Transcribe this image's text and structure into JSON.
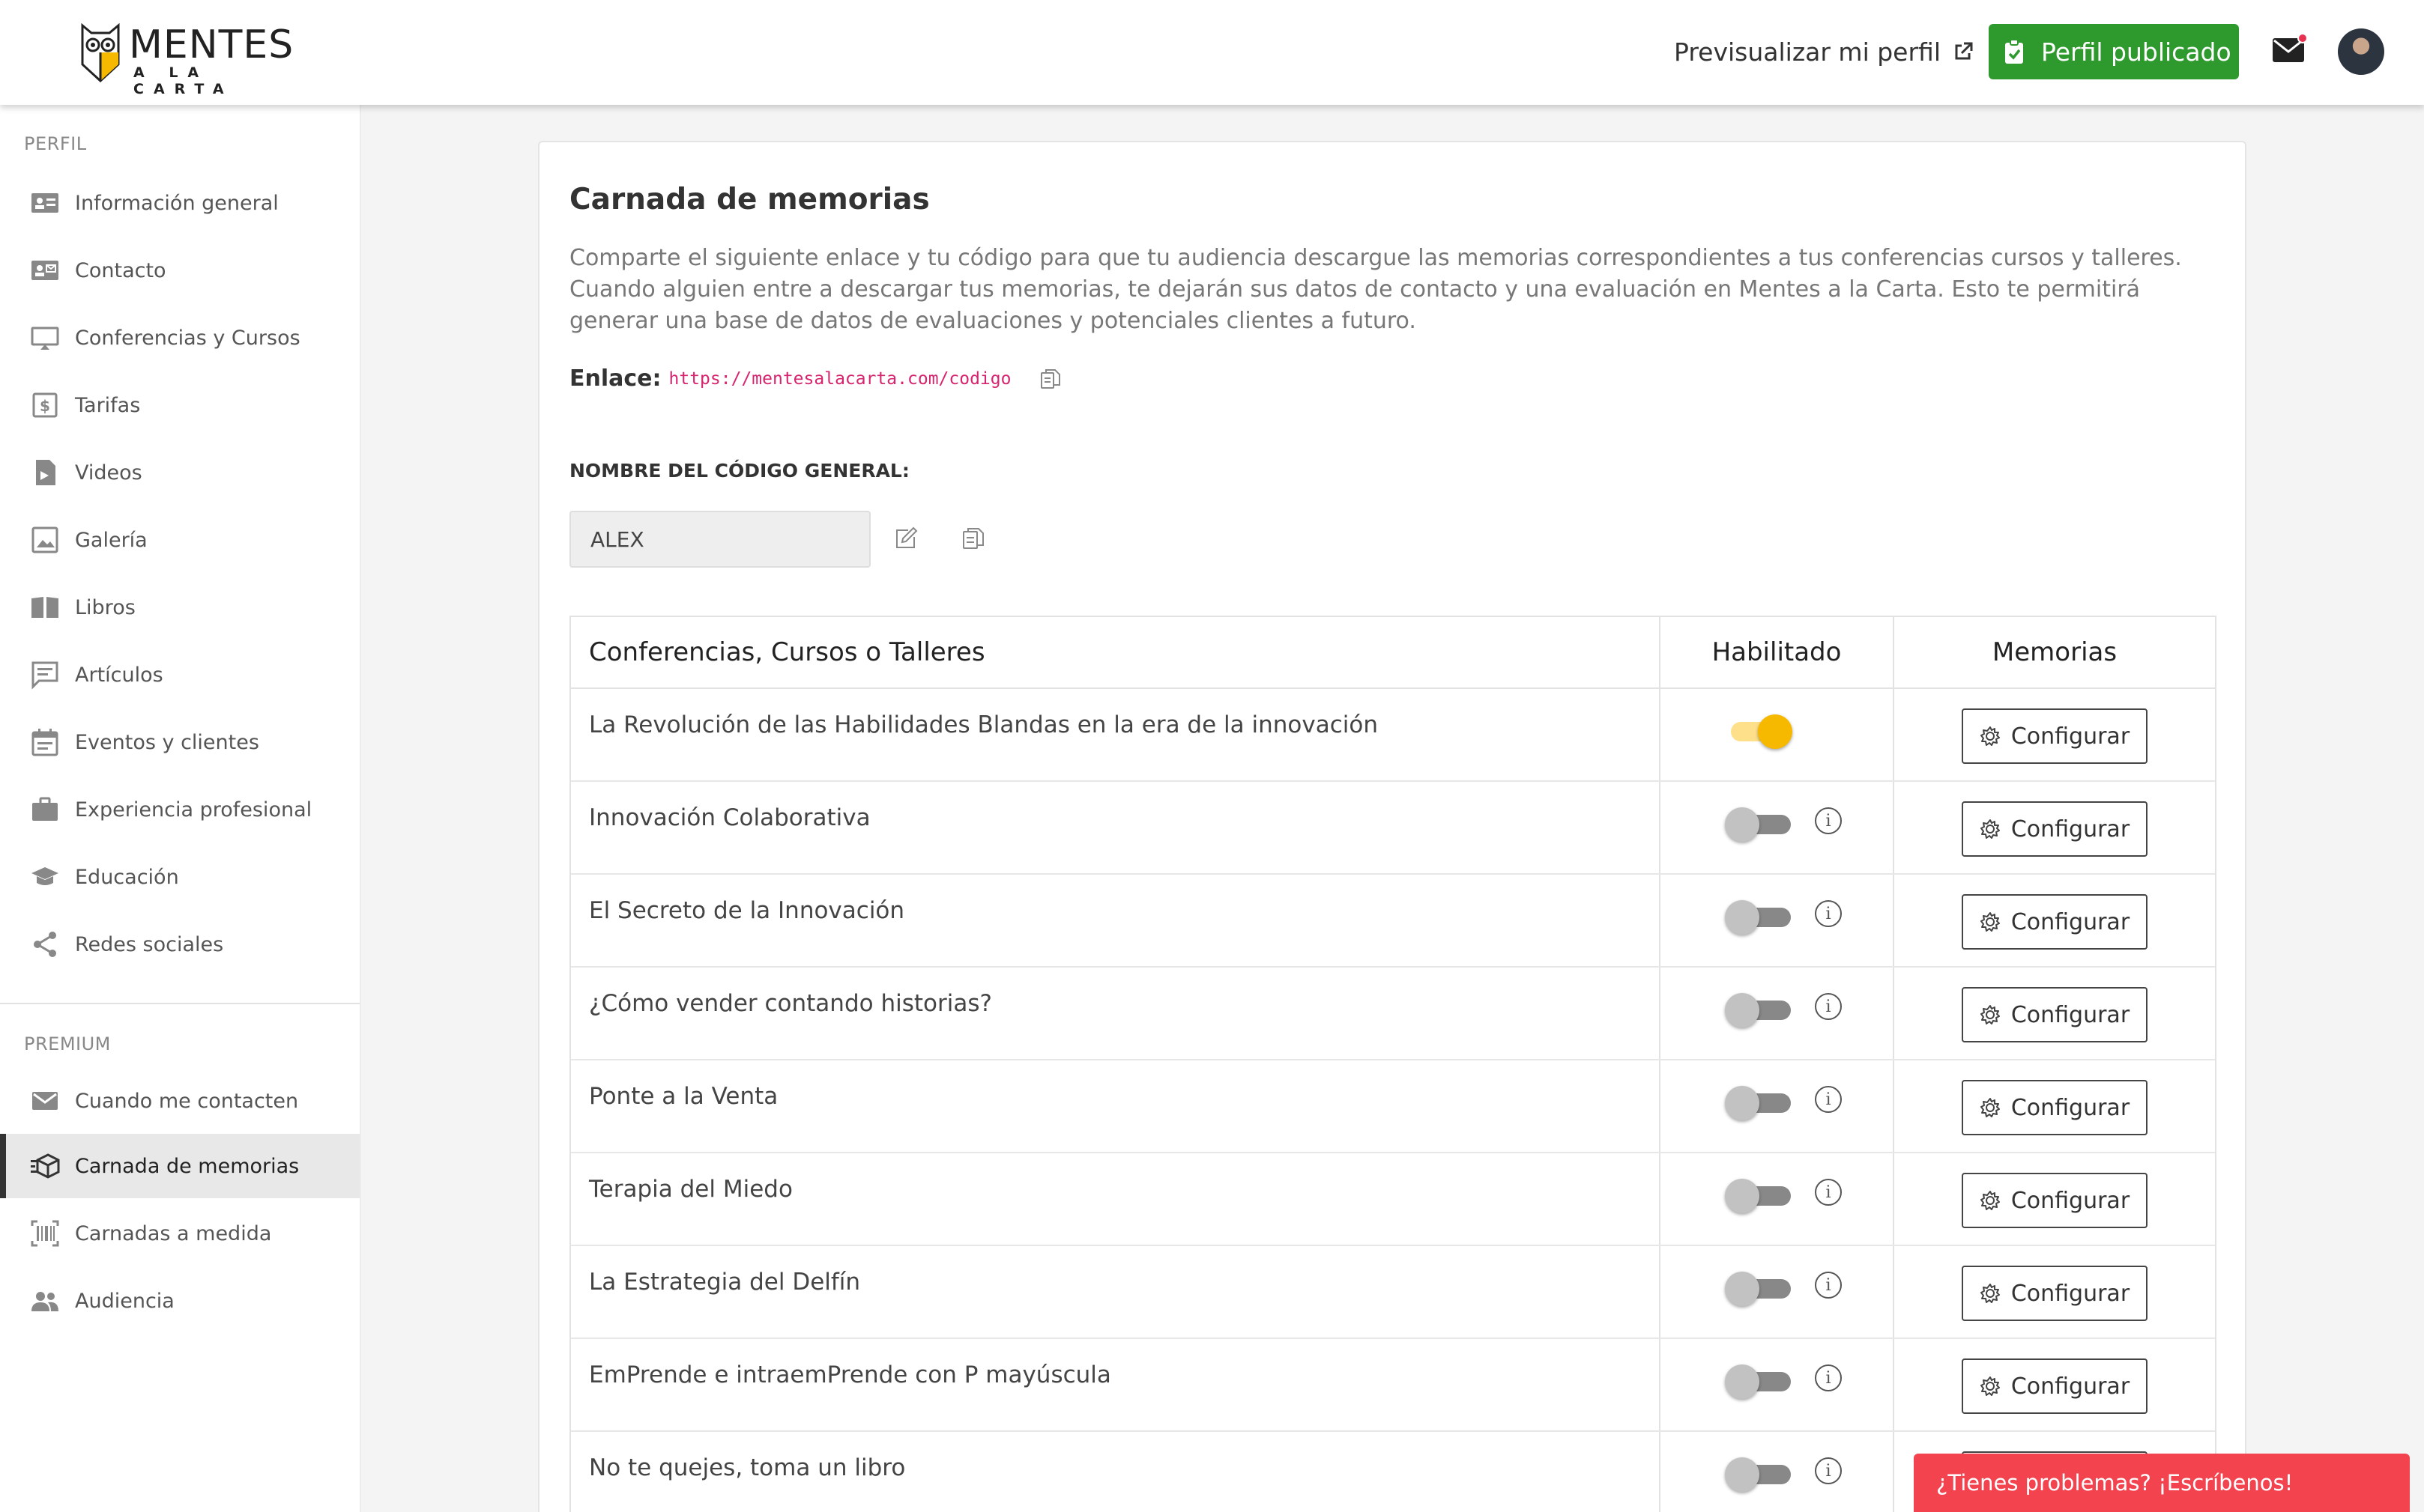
{
  "logo": {
    "word1": "MENTES",
    "word2": "A LA CARTA"
  },
  "header": {
    "preview_label": "Previsualizar mi perfil",
    "published_label": "Perfil publicado"
  },
  "sidebar": {
    "section_profile": "PERFIL",
    "profile_items": [
      {
        "label": "Información general",
        "icon": "id-card-icon"
      },
      {
        "label": "Contacto",
        "icon": "contact-card-icon"
      },
      {
        "label": "Conferencias y Cursos",
        "icon": "monitor-icon"
      },
      {
        "label": "Tarifas",
        "icon": "dollar-icon"
      },
      {
        "label": "Videos",
        "icon": "video-file-icon"
      },
      {
        "label": "Galería",
        "icon": "image-icon"
      },
      {
        "label": "Libros",
        "icon": "book-icon"
      },
      {
        "label": "Artículos",
        "icon": "comment-icon"
      },
      {
        "label": "Eventos y clientes",
        "icon": "calendar-icon"
      },
      {
        "label": "Experiencia profesional",
        "icon": "briefcase-icon"
      },
      {
        "label": "Educación",
        "icon": "graduation-cap-icon"
      },
      {
        "label": "Redes sociales",
        "icon": "share-icon"
      }
    ],
    "section_premium": "PREMIUM",
    "premium_items": [
      {
        "label": "Cuando me contacten",
        "icon": "envelope-icon"
      },
      {
        "label": "Carnada de memorias",
        "icon": "box-icon",
        "active": true
      },
      {
        "label": "Carnadas a medida",
        "icon": "barcode-icon"
      },
      {
        "label": "Audiencia",
        "icon": "people-icon"
      }
    ]
  },
  "main": {
    "title": "Carnada de memorias",
    "description": "Comparte el siguiente enlace y tu código para que tu audiencia descargue las memorias correspondientes a tus conferencias cursos y talleres. Cuando alguien entre a descargar tus memorias, te dejarán sus datos de contacto y una evaluación en Mentes a la Carta. Esto te permitirá generar una base de datos de evaluaciones y potenciales clientes a futuro.",
    "link_label": "Enlace:",
    "link_url": "https://mentesalacarta.com/codigo",
    "code_label": "NOMBRE DEL CÓDIGO GENERAL:",
    "code_value": "ALEX",
    "table": {
      "headers": [
        "Conferencias, Cursos o Talleres",
        "Habilitado",
        "Memorias"
      ],
      "configure_label": "Configurar",
      "rows": [
        {
          "name": "La Revolución de las Habilidades Blandas en la era de la innovación",
          "enabled": true
        },
        {
          "name": "Innovación Colaborativa",
          "enabled": false
        },
        {
          "name": "El Secreto de la Innovación",
          "enabled": false
        },
        {
          "name": "¿Cómo vender contando historias?",
          "enabled": false
        },
        {
          "name": "Ponte a la Venta",
          "enabled": false
        },
        {
          "name": "Terapia del Miedo",
          "enabled": false
        },
        {
          "name": "La Estrategia del Delfín",
          "enabled": false
        },
        {
          "name": "EmPrende e intraemPrende con P mayúscula",
          "enabled": false
        },
        {
          "name": "No te quejes, toma un libro",
          "enabled": false
        }
      ]
    }
  },
  "help": {
    "label": "¿Tienes problemas? ¡Escríbenos!"
  },
  "colors": {
    "accent_green": "#2e9a2e",
    "toggle_on": "#f6b900",
    "link": "#d6246e",
    "help_bg": "#f2434f"
  }
}
